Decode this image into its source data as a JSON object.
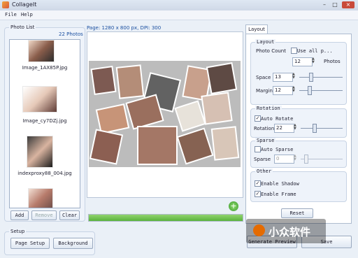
{
  "window": {
    "title": "CollageIt",
    "controls": [
      "–",
      "□",
      "×"
    ]
  },
  "menu": {
    "file": "File",
    "help": "Help"
  },
  "photo_list": {
    "legend": "Photo List",
    "count": "22 Photos",
    "items": [
      {
        "caption": "Image_1AX85P.jpg"
      },
      {
        "caption": "Image_cy7DZj.jpg"
      },
      {
        "caption": "indexproxy88_004.jpg"
      }
    ],
    "buttons": {
      "add": "Add",
      "remove": "Remove",
      "clear": "Clear"
    }
  },
  "page_info": "Page: 1280 x 800 px, DPI: 300",
  "progress": {
    "fraction": 1.0
  },
  "setup": {
    "legend": "Setup",
    "page_setup": "Page Setup",
    "background": "Background"
  },
  "layout_tab": {
    "tab_label": "Layout",
    "layout": {
      "legend": "Layout",
      "photo_count_label": "Photo Count",
      "use_all_label": "Use all p...",
      "photo_count_value": "12",
      "photos_suffix": "Photos",
      "space_label": "Space",
      "space_value": "13",
      "margin_label": "Margin",
      "margin_value": "12"
    },
    "rotation": {
      "legend": "Rotation",
      "auto_rotate": "Auto Rotate",
      "rotation_label": "Rotation",
      "rotation_value": "22"
    },
    "sparse": {
      "legend": "Sparse",
      "auto_sparse": "Auto Sparse",
      "sparse_label": "Sparse",
      "sparse_value": "0"
    },
    "other": {
      "legend": "Other",
      "enable_shadow": "Enable Shadow",
      "enable_frame": "Enable Frame"
    },
    "reset": "Reset"
  },
  "actions": {
    "generate_preview": "Generate Preview",
    "save": "Save"
  },
  "watermark": {
    "text": "小众软件"
  }
}
